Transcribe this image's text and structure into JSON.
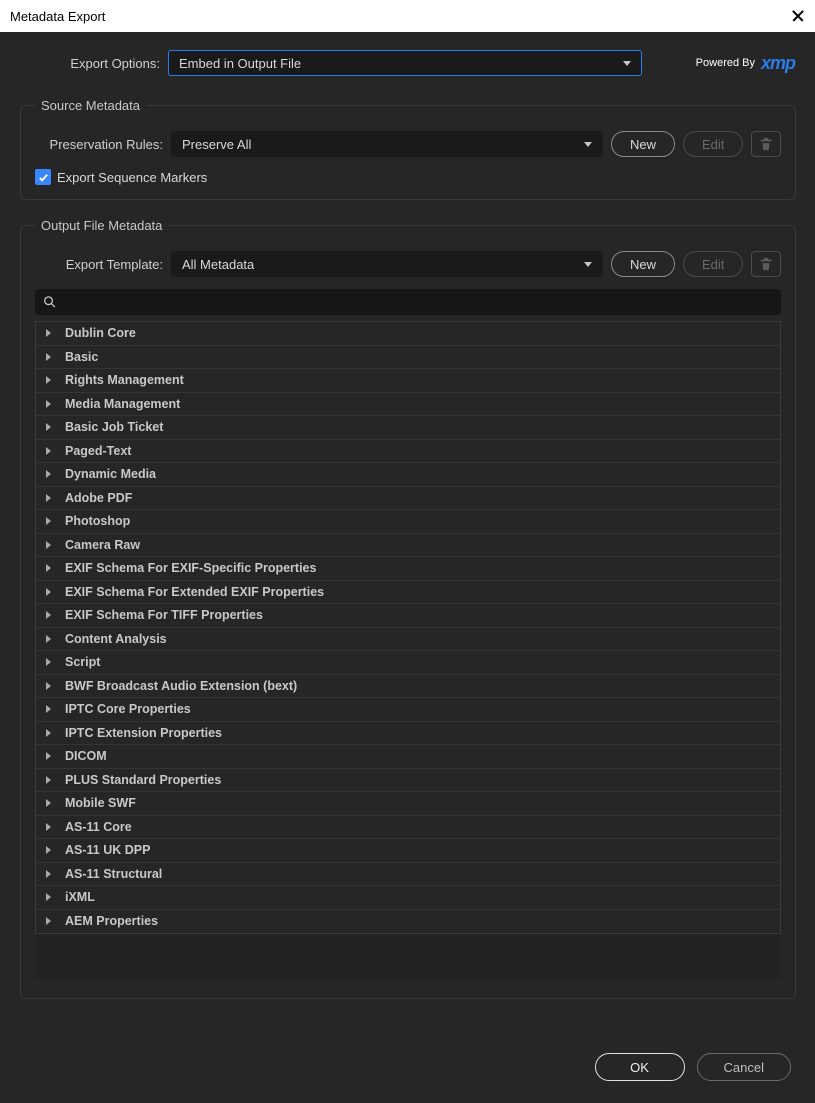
{
  "title": "Metadata Export",
  "powered_by": "Powered By",
  "xmp_brand": "xmp",
  "export_options": {
    "label": "Export Options:",
    "value": "Embed in Output File"
  },
  "source": {
    "legend": "Source Metadata",
    "rules_label": "Preservation Rules:",
    "rules_value": "Preserve All",
    "new_btn": "New",
    "edit_btn": "Edit",
    "markers_label": "Export Sequence Markers"
  },
  "output": {
    "legend": "Output File Metadata",
    "template_label": "Export Template:",
    "template_value": "All Metadata",
    "new_btn": "New",
    "edit_btn": "Edit",
    "search_placeholder": ""
  },
  "schemas": [
    "Dublin Core",
    "Basic",
    "Rights Management",
    "Media Management",
    "Basic Job Ticket",
    "Paged-Text",
    "Dynamic Media",
    "Adobe PDF",
    "Photoshop",
    "Camera Raw",
    "EXIF Schema For EXIF-Specific Properties",
    "EXIF Schema For Extended EXIF Properties",
    "EXIF Schema For TIFF Properties",
    "Content Analysis",
    "Script",
    "BWF Broadcast Audio Extension (bext)",
    "IPTC Core Properties",
    "IPTC Extension Properties",
    "DICOM",
    "PLUS Standard Properties",
    "Mobile SWF",
    "AS-11 Core",
    "AS-11 UK DPP",
    "AS-11 Structural",
    "iXML",
    "AEM Properties"
  ],
  "buttons": {
    "ok": "OK",
    "cancel": "Cancel"
  }
}
